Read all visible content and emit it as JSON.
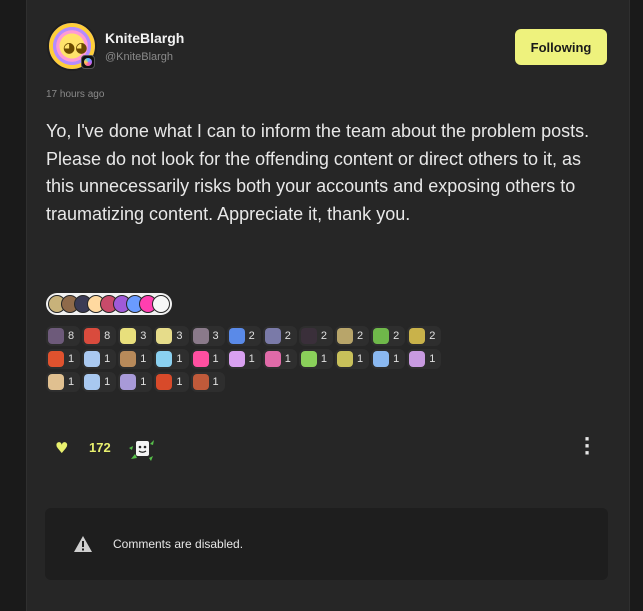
{
  "post": {
    "author_name": "KniteBlargh",
    "author_handle": "@KniteBlargh",
    "follow_label": "Following",
    "timestamp": "17 hours ago",
    "body": "Yo, I've done what I can to inform the team about the problem posts. Please do not look for the offending content or direct others to it, as this unnecessarily risks both your accounts and exposing others to traumatizing content. Appreciate it, thank you."
  },
  "reactor_avatars": [
    "#c8b27a",
    "#8f6a4a",
    "#3b3b55",
    "#ffd9a0",
    "#c94b6a",
    "#a05ad8",
    "#6a9bff",
    "#ff3fb0",
    "#f7f7f7"
  ],
  "reactions": [
    [
      {
        "icon": "ghost-emoji",
        "color": "#6d5a7a",
        "count": "8"
      },
      {
        "icon": "tomato-emoji",
        "color": "#d94b3d",
        "count": "8"
      },
      {
        "icon": "cat-emoji",
        "color": "#e8df7c",
        "count": "3"
      },
      {
        "icon": "bear-emoji",
        "color": "#e6dc8a",
        "count": "3"
      },
      {
        "icon": "raccoon-emoji",
        "color": "#8a7a8a",
        "count": "3"
      },
      {
        "icon": "flag-emoji",
        "color": "#5a8ae8",
        "count": "2"
      },
      {
        "icon": "goggles-emoji",
        "color": "#7a7aa8",
        "count": "2"
      },
      {
        "icon": "scythe-emoji",
        "color": "#3a2f3a",
        "count": "2"
      },
      {
        "icon": "mushroom-emoji",
        "color": "#b8a56a",
        "count": "2"
      },
      {
        "icon": "frog-emoji",
        "color": "#6fb84a",
        "count": "2"
      },
      {
        "icon": "goblin-emoji",
        "color": "#c9b24a",
        "count": "2"
      }
    ],
    [
      {
        "icon": "apple-emoji",
        "color": "#e0522e",
        "count": "1"
      },
      {
        "icon": "cloud-emoji",
        "color": "#a9c8f0",
        "count": "1"
      },
      {
        "icon": "puppy-emoji",
        "color": "#b88a5a",
        "count": "1"
      },
      {
        "icon": "music-emoji",
        "color": "#8ad0f0",
        "count": "1"
      },
      {
        "icon": "heart-emoji",
        "color": "#ff4fa0",
        "count": "1"
      },
      {
        "icon": "sparkle-emoji",
        "color": "#d8a0f0",
        "count": "1"
      },
      {
        "icon": "ghost-emoji",
        "color": "#e06aa8",
        "count": "1"
      },
      {
        "icon": "slime-emoji",
        "color": "#8ad05a",
        "count": "1"
      },
      {
        "icon": "lizard-emoji",
        "color": "#c8c05a",
        "count": "1"
      },
      {
        "icon": "fish-emoji",
        "color": "#8ab8f0",
        "count": "1"
      },
      {
        "icon": "confetti-emoji",
        "color": "#c89ae0",
        "count": "1"
      }
    ],
    [
      {
        "icon": "cupcake-emoji",
        "color": "#e0c090",
        "count": "1"
      },
      {
        "icon": "bubble-emoji",
        "color": "#a8c8f0",
        "count": "1"
      },
      {
        "icon": "shell-emoji",
        "color": "#a89ad8",
        "count": "1"
      },
      {
        "icon": "berry-emoji",
        "color": "#d84a2a",
        "count": "1"
      },
      {
        "icon": "pizza-emoji",
        "color": "#c05a3a",
        "count": "1"
      }
    ]
  ],
  "engagement": {
    "like_count": "172"
  },
  "comments": {
    "disabled_text": "Comments are disabled."
  }
}
